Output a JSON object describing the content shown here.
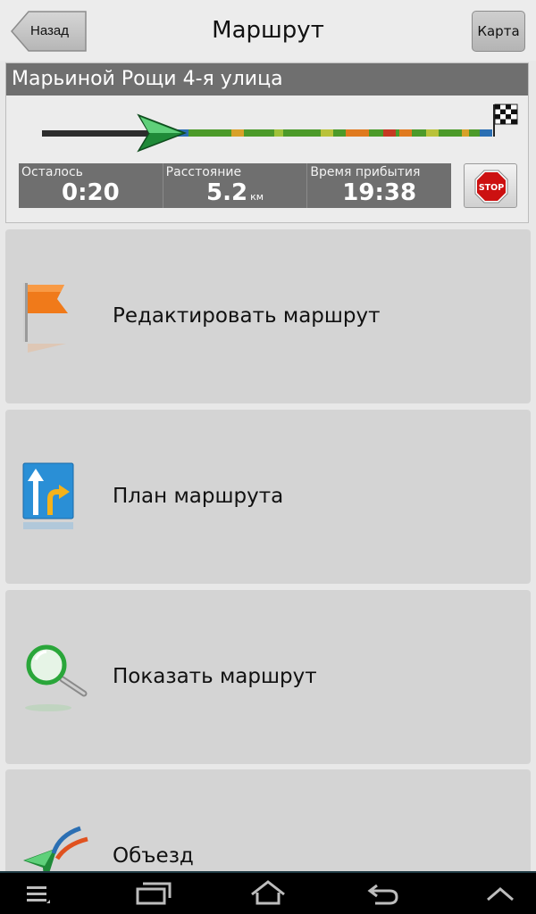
{
  "header": {
    "back_label": "Назад",
    "title": "Маршрут",
    "map_label": "Карта"
  },
  "route": {
    "street": "Марьиной Рощи 4-я улица",
    "stats": [
      {
        "label": "Осталось",
        "value": "0:20",
        "unit": ""
      },
      {
        "label": "Расстояние",
        "value": "5.2",
        "unit": "км"
      },
      {
        "label": "Время прибытия",
        "value": "19:38",
        "unit": ""
      }
    ],
    "stop_label": "STOP"
  },
  "menu": [
    {
      "label": "Редактировать маршрут",
      "icon": "orange-flag-icon"
    },
    {
      "label": "План маршрута",
      "icon": "route-plan-arrows-icon"
    },
    {
      "label": "Показать маршрут",
      "icon": "magnifier-icon"
    },
    {
      "label": "Объезд",
      "icon": "detour-arrows-icon"
    }
  ],
  "colors": {
    "header_bg": "#ececec",
    "panel_dark": "#6f6f6f",
    "menu_item_bg": "#d4d4d4",
    "route_green": "#4c9a2a",
    "stop_red": "#cc1111"
  },
  "navbar": {
    "icons": [
      "menu-icon",
      "recent-apps-icon",
      "home-icon",
      "back-icon",
      "collapse-icon"
    ]
  }
}
